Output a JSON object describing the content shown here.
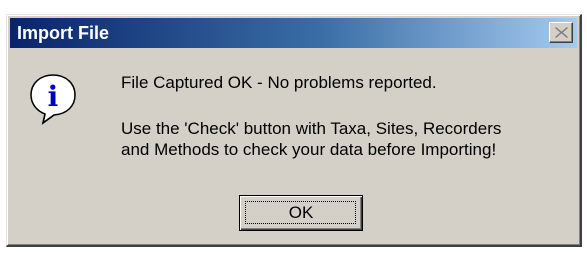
{
  "window": {
    "title": "Import File",
    "close_icon": "close-icon"
  },
  "message": {
    "icon": "info-icon",
    "icon_glyph": "i",
    "line1": "File Captured OK - No problems reported.",
    "detail_line1": "Use the 'Check' button with Taxa, Sites, Recorders",
    "detail_line2": "and Methods to check your data before Importing!"
  },
  "buttons": {
    "ok_label": "OK"
  },
  "colors": {
    "dialog_face": "#d4d0c8",
    "title_start": "#0a246a",
    "title_end": "#a6caf0",
    "info_blue": "#0000c0"
  }
}
